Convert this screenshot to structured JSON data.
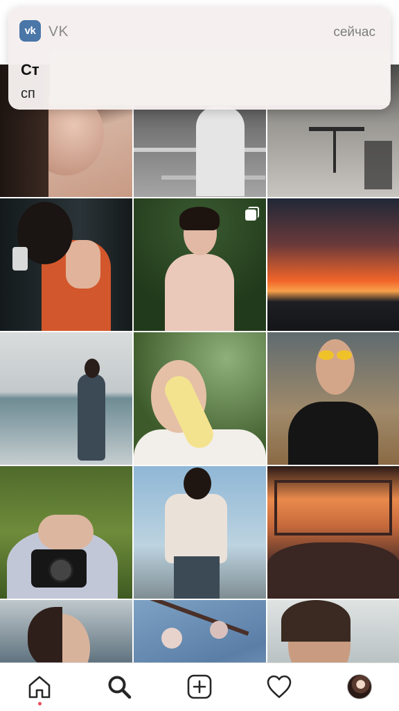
{
  "notification": {
    "app_name": "VK",
    "app_icon_label": "vk",
    "time": "сейчас",
    "title": "Ст",
    "body": "сп"
  },
  "grid": {
    "tiles": [
      {
        "name": "photo-portrait-closeup",
        "colors": [
          "#caa690",
          "#2a1d18"
        ]
      },
      {
        "name": "photo-bw-balcony",
        "colors": [
          "#8e8e8e",
          "#2e2e2e"
        ]
      },
      {
        "name": "photo-cafe-terrace",
        "colors": [
          "#b9b6b1",
          "#4a4844"
        ]
      },
      {
        "name": "photo-mirror-selfie",
        "colors": [
          "#1c2326",
          "#d0582f"
        ]
      },
      {
        "name": "photo-pink-coat-tree",
        "colors": [
          "#3d5a2d",
          "#e6c3b3"
        ]
      },
      {
        "name": "photo-sunset-sky",
        "colors": [
          "#f0642a",
          "#242831"
        ]
      },
      {
        "name": "photo-beach-girl",
        "colors": [
          "#cfd5d8",
          "#4a5d66"
        ]
      },
      {
        "name": "photo-banana-palm",
        "colors": [
          "#6b8a4a",
          "#f1ece6"
        ]
      },
      {
        "name": "photo-yellow-glasses",
        "colors": [
          "#b68b5a",
          "#1c1c1c"
        ]
      },
      {
        "name": "photo-grass-camera",
        "colors": [
          "#587533",
          "#d6b5a1"
        ]
      },
      {
        "name": "photo-sky-sunglasses",
        "colors": [
          "#91b6cf",
          "#e9e0d7"
        ]
      },
      {
        "name": "photo-bedroom-window",
        "colors": [
          "#e07a43",
          "#4a302c"
        ]
      },
      {
        "name": "photo-city-portrait",
        "colors": [
          "#5a6e7b",
          "#3a2a24"
        ]
      },
      {
        "name": "photo-blossom-branch",
        "colors": [
          "#6d8fb6",
          "#d9c7c2"
        ]
      },
      {
        "name": "photo-sea-portrait",
        "colors": [
          "#b7c0c2",
          "#3a2a22"
        ]
      }
    ]
  },
  "tabbar": {
    "home": "home-icon",
    "search": "search-icon",
    "add": "add-post-icon",
    "activity": "heart-icon",
    "profile": "profile-avatar"
  }
}
